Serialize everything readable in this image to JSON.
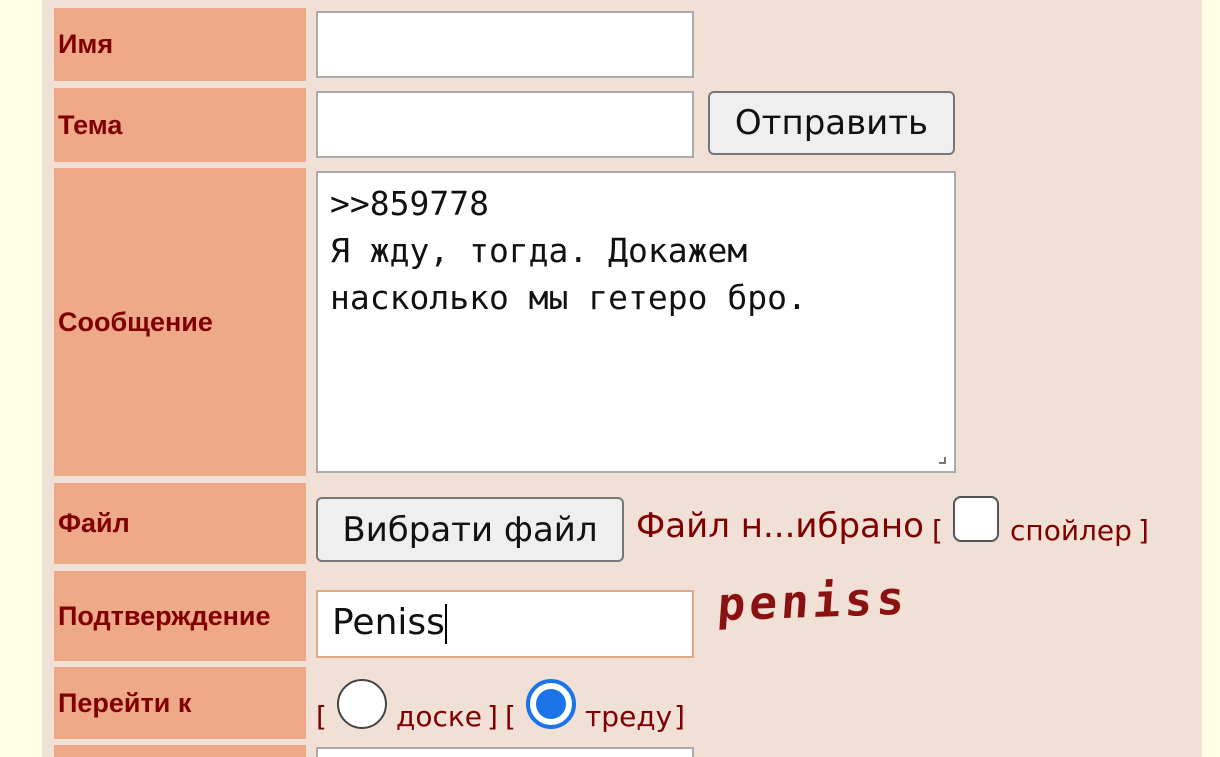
{
  "form": {
    "name_label": "Имя",
    "name_value": "",
    "subject_label": "Тема",
    "subject_value": "",
    "submit_label": "Отправить",
    "message_label": "Сообщение",
    "message_value": ">>859778\nЯ жду, тогда. Докажем\nнасколько мы гетеро бро.",
    "file_label": "Файл",
    "file_button_label": "Вибрати файл",
    "file_status": "Файл н...ибрано",
    "bracket_open": "[",
    "bracket_close": "]",
    "spoiler_label": "спойлер",
    "spoiler_checked": false,
    "captcha_label": "Подтверждение",
    "captcha_value": "Peniss",
    "captcha_image_text": "peniss",
    "goto_label": "Перейти к",
    "goto_options": [
      {
        "label": "доске",
        "checked": false
      },
      {
        "label": "треду",
        "checked": true
      }
    ]
  },
  "colors": {
    "background": "#ffffe6",
    "panel": "#f0e0d6",
    "label_bg": "#eeaa88",
    "label_text": "#800000",
    "accent": "#1a73e8"
  }
}
